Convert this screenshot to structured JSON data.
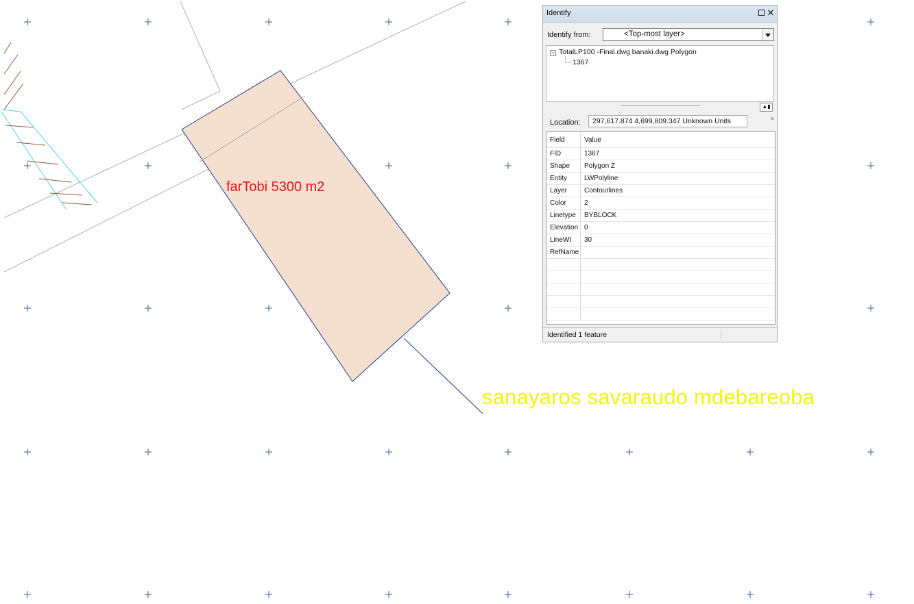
{
  "map": {
    "parcel_label": "farTobi 5300 m2",
    "leader_label": "sanayaros savaraudo mdebareoba",
    "colors": {
      "parcel_fill": "#f5dfcf",
      "parcel_outline": "#1f3a8a",
      "parcel_label": "#e0141b",
      "leader_label": "#f5f20a",
      "grid_mark": "#3a5b9e",
      "contour": "#4fd3ea",
      "hatch": "#8b5a3c",
      "road_line": "#9a9a9a"
    }
  },
  "identify": {
    "title": "Identify",
    "from_label": "Identify from:",
    "from_value": "<Top-most layer>",
    "tree_root": "TotalLP100 -Final.dwg banaki.dwg Polygon",
    "tree_child": "1367",
    "location_label": "Location:",
    "location_value": "297,617.874  4,699,809.347 Unknown Units",
    "header": {
      "field": "Field",
      "value": "Value"
    },
    "rows": [
      {
        "field": "FID",
        "value": "1367"
      },
      {
        "field": "Shape",
        "value": "Polygon Z"
      },
      {
        "field": "Entity",
        "value": "LWPolyline"
      },
      {
        "field": "Layer",
        "value": "Contourlines"
      },
      {
        "field": "Color",
        "value": "2"
      },
      {
        "field": "Linetype",
        "value": "BYBLOCK"
      },
      {
        "field": "Elevation",
        "value": "0"
      },
      {
        "field": "LineWt",
        "value": "30"
      },
      {
        "field": "RefName",
        "value": ""
      },
      {
        "field": "",
        "value": ""
      },
      {
        "field": "",
        "value": ""
      },
      {
        "field": "",
        "value": ""
      },
      {
        "field": "",
        "value": ""
      },
      {
        "field": "",
        "value": ""
      }
    ],
    "status": "Identified 1 feature"
  }
}
